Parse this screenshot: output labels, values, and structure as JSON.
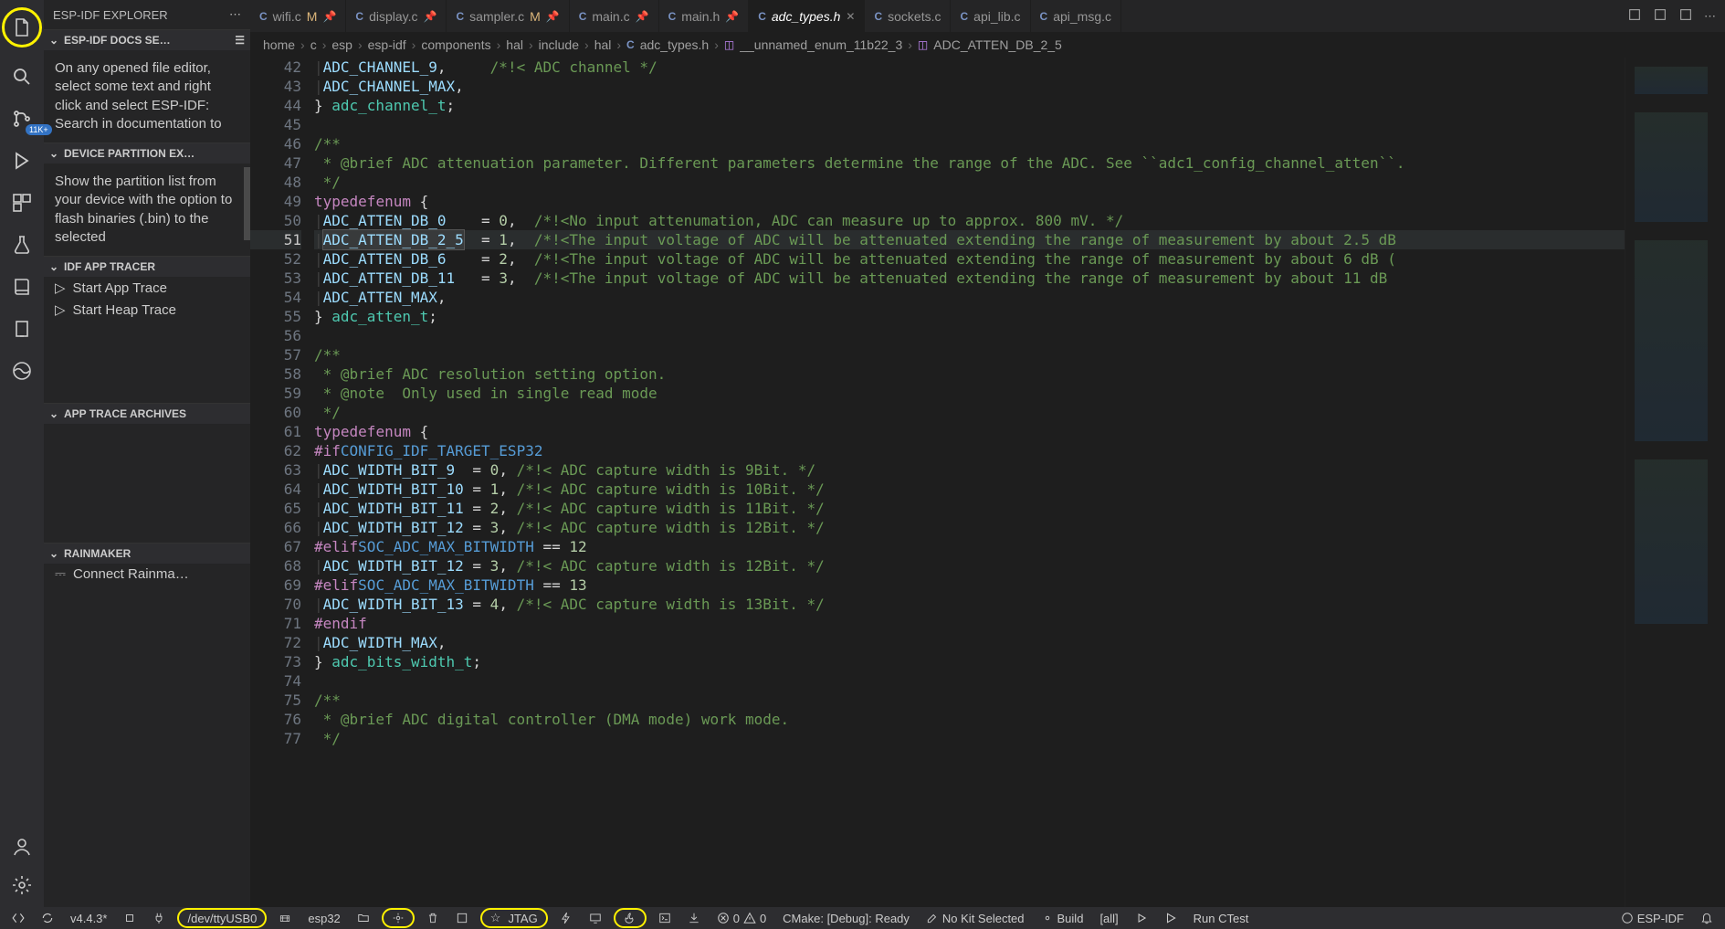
{
  "activity": {
    "badge": "11K+"
  },
  "sidebar": {
    "title": "ESP-IDF EXPLORER",
    "sections": [
      {
        "header": "ESP-IDF DOCS SE…",
        "body": "On any opened file editor, select some text and right click and select ESP-IDF: Search in documentation to"
      },
      {
        "header": "DEVICE PARTITION EX…",
        "body": "Show the partition list from your device with the option to flash binaries (.bin) to the selected"
      },
      {
        "header": "IDF APP TRACER",
        "actions": [
          "Start App Trace",
          "Start Heap Trace"
        ]
      },
      {
        "header": "APP TRACE ARCHIVES"
      },
      {
        "header": "RAINMAKER",
        "actions": [
          "Connect Rainma…"
        ]
      }
    ]
  },
  "tabs": [
    {
      "label": "wifi.c",
      "pinned": true,
      "mod": "M"
    },
    {
      "label": "display.c",
      "pinned": true
    },
    {
      "label": "sampler.c",
      "pinned": true,
      "mod": "M"
    },
    {
      "label": "main.c",
      "pinned": true
    },
    {
      "label": "main.h",
      "pinned": true
    },
    {
      "label": "adc_types.h",
      "active": true,
      "close": true,
      "italic": true
    },
    {
      "label": "sockets.c"
    },
    {
      "label": "api_lib.c"
    },
    {
      "label": "api_msg.c"
    }
  ],
  "breadcrumbs": [
    "home",
    "c",
    "esp",
    "esp-idf",
    "components",
    "hal",
    "include",
    "hal",
    "adc_types.h",
    "__unnamed_enum_11b22_3",
    "ADC_ATTEN_DB_2_5"
  ],
  "breadcrumb_icons": {
    "8": "C",
    "9": "enum",
    "10": "enum"
  },
  "editor": {
    "highlight_line": 51,
    "selected_token": "ADC_ATTEN_DB_2_5",
    "lines": [
      {
        "n": 42,
        "seg": [
          [
            "",
            "    "
          ],
          [
            "id",
            "ADC_CHANNEL_9"
          ],
          [
            "",
            "",
            ","
          ],
          [
            "pad",
            "     "
          ],
          [
            "cmt",
            "/*!< ADC channel */"
          ]
        ]
      },
      {
        "n": 43,
        "seg": [
          [
            "",
            "    "
          ],
          [
            "id",
            "ADC_CHANNEL_MAX"
          ],
          [
            "",
            "",
            ","
          ]
        ]
      },
      {
        "n": 44,
        "seg": [
          [
            "",
            "} "
          ],
          [
            "type",
            "adc_channel_t"
          ],
          [
            "",
            ";"
          ]
        ]
      },
      {
        "n": 45,
        "seg": []
      },
      {
        "n": 46,
        "seg": [
          [
            "cmt",
            "/**"
          ]
        ]
      },
      {
        "n": 47,
        "seg": [
          [
            "cmt",
            " * @brief ADC attenuation parameter. Different parameters determine the range of the ADC. See ``adc1_config_channel_atten``."
          ]
        ]
      },
      {
        "n": 48,
        "seg": [
          [
            "cmt",
            " */"
          ]
        ]
      },
      {
        "n": 49,
        "seg": [
          [
            "kw",
            "typedef"
          ],
          [
            "",
            " "
          ],
          [
            "kw",
            "enum"
          ],
          [
            "",
            " {"
          ]
        ]
      },
      {
        "n": 50,
        "seg": [
          [
            "",
            "    "
          ],
          [
            "id",
            "ADC_ATTEN_DB_0"
          ],
          [
            "",
            "    = "
          ],
          [
            "num",
            "0"
          ],
          [
            "",
            "",
            ","
          ],
          [
            "pad",
            "  "
          ],
          [
            "cmt",
            "/*!<No input attenumation, ADC can measure up to approx. 800 mV. */"
          ]
        ]
      },
      {
        "n": 51,
        "seg": [
          [
            "",
            "    "
          ],
          [
            "sel",
            "ADC_ATTEN_DB_2_5"
          ],
          [
            "",
            "  = "
          ],
          [
            "num",
            "1"
          ],
          [
            "",
            "",
            ","
          ],
          [
            "pad",
            "  "
          ],
          [
            "cmt",
            "/*!<The input voltage of ADC will be attenuated extending the range of measurement by about 2.5 dB"
          ]
        ]
      },
      {
        "n": 52,
        "seg": [
          [
            "",
            "    "
          ],
          [
            "id",
            "ADC_ATTEN_DB_6"
          ],
          [
            "",
            "    = "
          ],
          [
            "num",
            "2"
          ],
          [
            "",
            "",
            ","
          ],
          [
            "pad",
            "  "
          ],
          [
            "cmt",
            "/*!<The input voltage of ADC will be attenuated extending the range of measurement by about 6 dB ("
          ]
        ]
      },
      {
        "n": 53,
        "seg": [
          [
            "",
            "    "
          ],
          [
            "id",
            "ADC_ATTEN_DB_11"
          ],
          [
            "",
            "   = "
          ],
          [
            "num",
            "3"
          ],
          [
            "",
            "",
            ","
          ],
          [
            "pad",
            "  "
          ],
          [
            "cmt",
            "/*!<The input voltage of ADC will be attenuated extending the range of measurement by about 11 dB"
          ]
        ]
      },
      {
        "n": 54,
        "seg": [
          [
            "",
            "    "
          ],
          [
            "id",
            "ADC_ATTEN_MAX"
          ],
          [
            "",
            "",
            ","
          ]
        ]
      },
      {
        "n": 55,
        "seg": [
          [
            "",
            "} "
          ],
          [
            "type",
            "adc_atten_t"
          ],
          [
            "",
            ";"
          ]
        ]
      },
      {
        "n": 56,
        "seg": []
      },
      {
        "n": 57,
        "seg": [
          [
            "cmt",
            "/**"
          ]
        ]
      },
      {
        "n": 58,
        "seg": [
          [
            "cmt",
            " * @brief ADC resolution setting option."
          ]
        ]
      },
      {
        "n": 59,
        "seg": [
          [
            "cmt",
            " * @note  Only used in single read mode"
          ]
        ]
      },
      {
        "n": 60,
        "seg": [
          [
            "cmt",
            " */"
          ]
        ]
      },
      {
        "n": 61,
        "seg": [
          [
            "kw",
            "typedef"
          ],
          [
            "",
            " "
          ],
          [
            "kw",
            "enum"
          ],
          [
            "",
            " {"
          ]
        ]
      },
      {
        "n": 62,
        "seg": [
          [
            "pp",
            "#if"
          ],
          [
            "",
            " "
          ],
          [
            "macro",
            "CONFIG_IDF_TARGET_ESP32"
          ]
        ]
      },
      {
        "n": 63,
        "seg": [
          [
            "",
            "    "
          ],
          [
            "id",
            "ADC_WIDTH_BIT_9"
          ],
          [
            "",
            "  = "
          ],
          [
            "num",
            "0"
          ],
          [
            "",
            "",
            ", "
          ],
          [
            "cmt",
            "/*!< ADC capture width is 9Bit. */"
          ]
        ]
      },
      {
        "n": 64,
        "seg": [
          [
            "",
            "    "
          ],
          [
            "id",
            "ADC_WIDTH_BIT_10"
          ],
          [
            "",
            " = "
          ],
          [
            "num",
            "1"
          ],
          [
            "",
            "",
            ", "
          ],
          [
            "cmt",
            "/*!< ADC capture width is 10Bit. */"
          ]
        ]
      },
      {
        "n": 65,
        "seg": [
          [
            "",
            "    "
          ],
          [
            "id",
            "ADC_WIDTH_BIT_11"
          ],
          [
            "",
            " = "
          ],
          [
            "num",
            "2"
          ],
          [
            "",
            "",
            ", "
          ],
          [
            "cmt",
            "/*!< ADC capture width is 11Bit. */"
          ]
        ]
      },
      {
        "n": 66,
        "seg": [
          [
            "",
            "    "
          ],
          [
            "id",
            "ADC_WIDTH_BIT_12"
          ],
          [
            "",
            " = "
          ],
          [
            "num",
            "3"
          ],
          [
            "",
            "",
            ", "
          ],
          [
            "cmt",
            "/*!< ADC capture width is 12Bit. */"
          ]
        ]
      },
      {
        "n": 67,
        "seg": [
          [
            "pp",
            "#elif"
          ],
          [
            "",
            " "
          ],
          [
            "macro",
            "SOC_ADC_MAX_BITWIDTH"
          ],
          [
            "",
            " == "
          ],
          [
            "num",
            "12"
          ]
        ]
      },
      {
        "n": 68,
        "seg": [
          [
            "",
            "    "
          ],
          [
            "id",
            "ADC_WIDTH_BIT_12"
          ],
          [
            "",
            " = "
          ],
          [
            "num",
            "3"
          ],
          [
            "",
            "",
            ", "
          ],
          [
            "cmt",
            "/*!< ADC capture width is 12Bit. */"
          ]
        ]
      },
      {
        "n": 69,
        "seg": [
          [
            "pp",
            "#elif"
          ],
          [
            "",
            " "
          ],
          [
            "macro",
            "SOC_ADC_MAX_BITWIDTH"
          ],
          [
            "",
            " == "
          ],
          [
            "num",
            "13"
          ]
        ]
      },
      {
        "n": 70,
        "seg": [
          [
            "",
            "    "
          ],
          [
            "id",
            "ADC_WIDTH_BIT_13"
          ],
          [
            "",
            " = "
          ],
          [
            "num",
            "4"
          ],
          [
            "",
            "",
            ", "
          ],
          [
            "cmt",
            "/*!< ADC capture width is 13Bit. */"
          ]
        ]
      },
      {
        "n": 71,
        "seg": [
          [
            "pp",
            "#endif"
          ]
        ]
      },
      {
        "n": 72,
        "seg": [
          [
            "",
            "    "
          ],
          [
            "id",
            "ADC_WIDTH_MAX"
          ],
          [
            "",
            "",
            ","
          ]
        ]
      },
      {
        "n": 73,
        "seg": [
          [
            "",
            "} "
          ],
          [
            "type",
            "adc_bits_width_t"
          ],
          [
            "",
            ";"
          ]
        ]
      },
      {
        "n": 74,
        "seg": []
      },
      {
        "n": 75,
        "seg": [
          [
            "cmt",
            "/**"
          ]
        ]
      },
      {
        "n": 76,
        "seg": [
          [
            "cmt",
            " * @brief ADC digital controller (DMA mode) work mode."
          ]
        ]
      },
      {
        "n": 77,
        "seg": [
          [
            "cmt",
            " */"
          ]
        ]
      }
    ]
  },
  "status": {
    "version": "v4.4.3*",
    "port": "/dev/ttyUSB0",
    "target": "esp32",
    "jtag": "JTAG",
    "errors": "0",
    "warnings": "0",
    "cmake": "CMake: [Debug]: Ready",
    "kit": "No Kit Selected",
    "build": "Build",
    "target2": "[all]",
    "ctest": "Run CTest",
    "espidf": "ESP-IDF"
  }
}
